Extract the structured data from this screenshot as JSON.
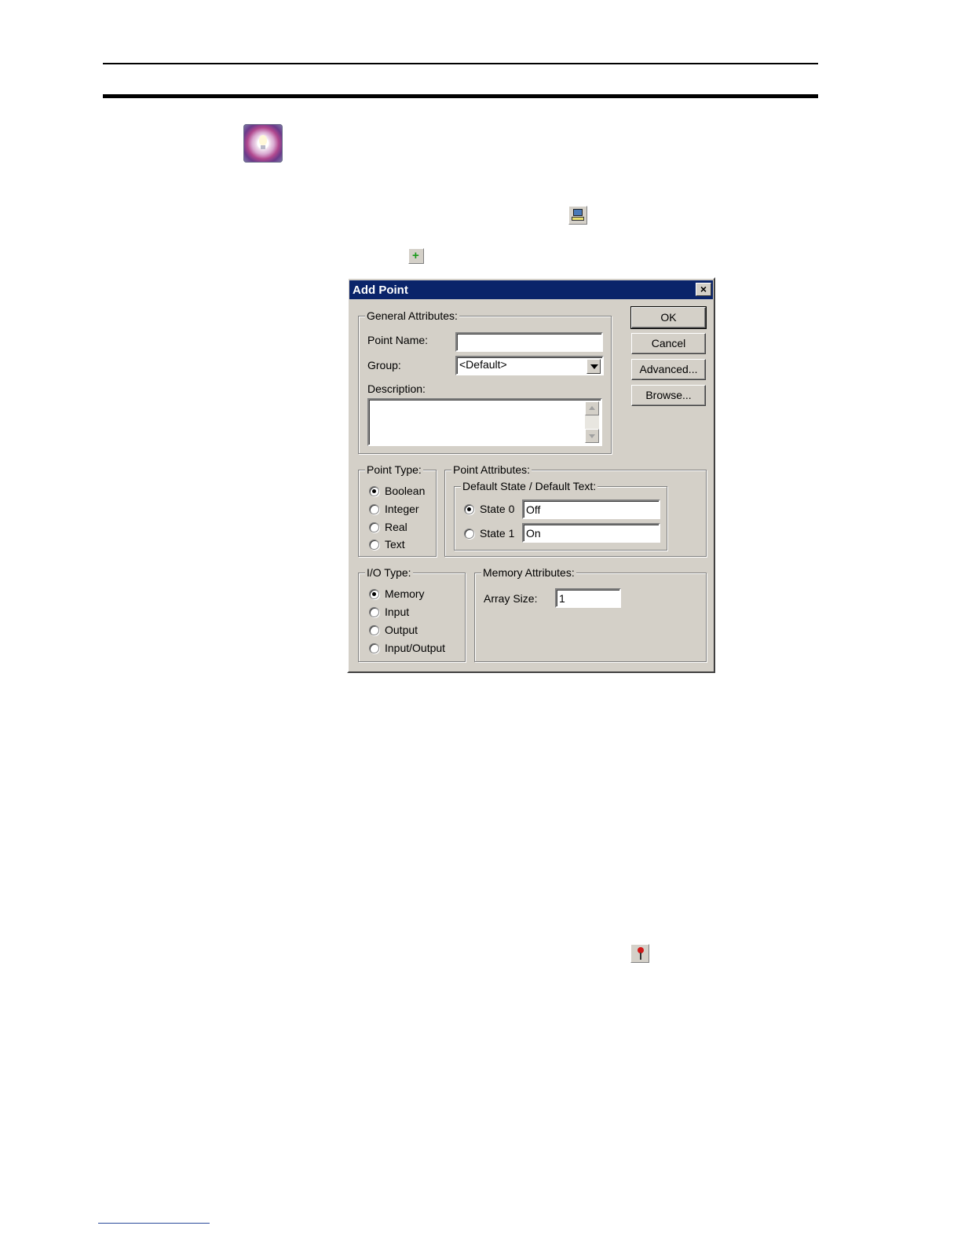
{
  "dialog": {
    "title": "Add Point",
    "close_glyph": "×",
    "general": {
      "legend": "General Attributes:",
      "point_name_label": "Point Name:",
      "point_name_value": "",
      "group_label": "Group:",
      "group_value": "<Default>",
      "description_label": "Description:",
      "description_value": ""
    },
    "buttons": {
      "ok": "OK",
      "cancel": "Cancel",
      "advanced": "Advanced...",
      "browse": "Browse..."
    },
    "point_type": {
      "legend": "Point Type:",
      "options": [
        "Boolean",
        "Integer",
        "Real",
        "Text"
      ],
      "selected": "Boolean"
    },
    "point_attributes": {
      "legend": "Point Attributes:",
      "default_state": {
        "legend": "Default State / Default Text:",
        "state0_label": "State 0",
        "state0_value": "Off",
        "state1_label": "State 1",
        "state1_value": "On",
        "selected": "State 0"
      }
    },
    "io_type": {
      "legend": "I/O Type:",
      "options": [
        "Memory",
        "Input",
        "Output",
        "Input/Output"
      ],
      "selected": "Memory"
    },
    "memory_attributes": {
      "legend": "Memory Attributes:",
      "array_size_label": "Array Size:",
      "array_size_value": "1"
    }
  },
  "icons": [
    "application-icon",
    "pc-toolbar-icon",
    "add-point-icon",
    "pin-toolbar-icon"
  ]
}
